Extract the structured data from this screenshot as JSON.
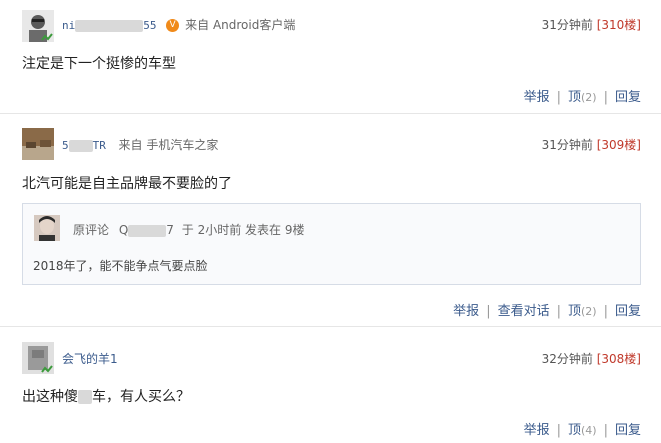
{
  "comments": [
    {
      "username_prefix": "ni",
      "username_suffix": "55",
      "source": "来自 Android客户端",
      "time": "31分钟前",
      "floor": "[310楼]",
      "content": "注定是下一个挺惨的车型",
      "actions": {
        "report": "举报",
        "upvote": "顶",
        "upvote_count": "(2)",
        "reply": "回复"
      }
    },
    {
      "username_prefix": "5",
      "username_suffix": "TR",
      "source": "来自 手机汽车之家",
      "time": "31分钟前",
      "floor": "[309楼]",
      "content": "北汽可能是自主品牌最不要脸的了",
      "quote": {
        "label": "原评论",
        "user_prefix": "Q",
        "user_suffix": "7",
        "at": "于 2小时前 发表在 9楼",
        "text": "2018年了，能不能争点气要点脸"
      },
      "actions": {
        "report": "举报",
        "view_dialog": "查看对话",
        "upvote": "顶",
        "upvote_count": "(2)",
        "reply": "回复"
      }
    },
    {
      "username": "会飞的羊1",
      "time": "32分钟前",
      "floor": "[308楼]",
      "content_before": "出这种傻",
      "content_after": "车，有人买么？",
      "actions": {
        "report": "举报",
        "upvote": "顶",
        "upvote_count": "(4)",
        "reply": "回复"
      }
    }
  ],
  "colors": {
    "link": "#3b5b8c",
    "floor": "#c0392b",
    "vip_badge": "#f08a1a"
  },
  "icons": {
    "vip": "v-badge-icon",
    "verified": "verified-check-icon"
  }
}
